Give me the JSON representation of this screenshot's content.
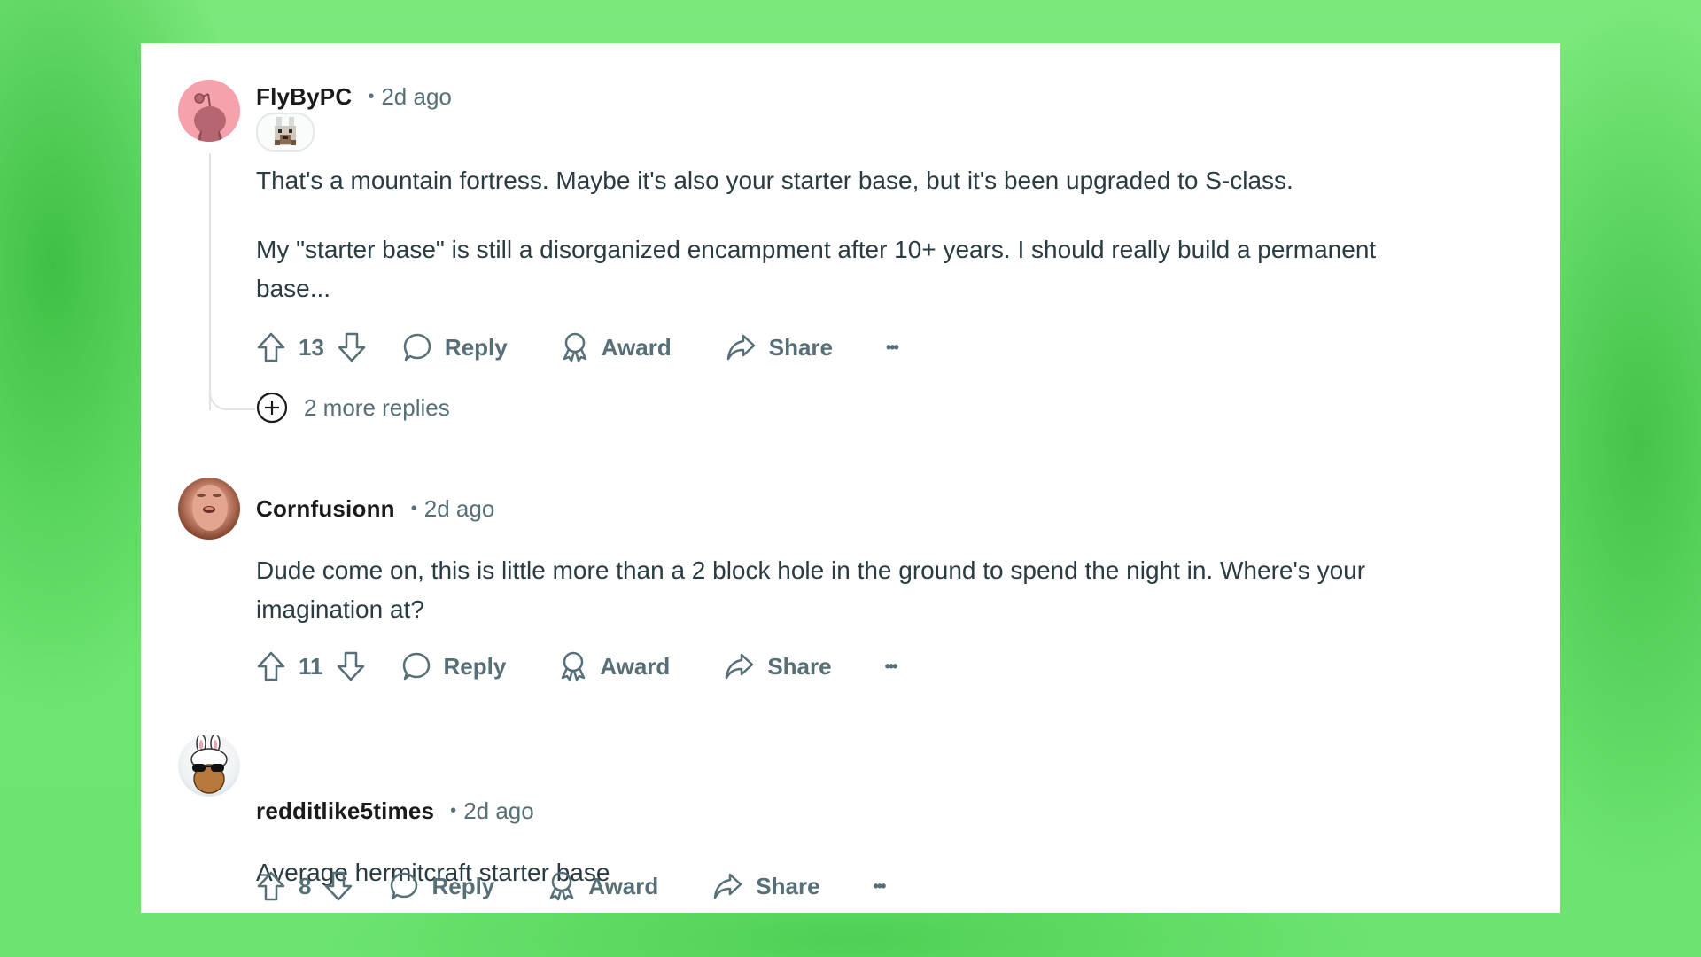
{
  "colors": {
    "background_green": "#6fe672",
    "card": "#ffffff",
    "text_primary": "#1a1a1b",
    "text_body": "#2a3c42",
    "text_muted": "#576f76",
    "avatar_pink": "#f6a2ac"
  },
  "comments": [
    {
      "username": "FlyByPC",
      "separator": "•",
      "time": "2d ago",
      "avatar": "snoo-default-avatar-pink",
      "flair": "minecraft-wolf-flair-icon",
      "paragraphs": [
        "That's a mountain fortress. Maybe it's also your starter base, but it's been upgraded to S-class.",
        "My \"starter base\" is still a disorganized encampment after 10+ years. I should really build a permanent base..."
      ],
      "score": "13",
      "actions": {
        "reply": "Reply",
        "award": "Award",
        "share": "Share",
        "more": "•••"
      },
      "more_replies": "2 more replies"
    },
    {
      "username": "Cornfusionn",
      "separator": "•",
      "time": "2d ago",
      "avatar": "photo-face-avatar",
      "paragraphs": [
        "Dude come on, this is little more than a 2 block hole in the ground to spend the night in. Where's your imagination at?"
      ],
      "score": "11",
      "actions": {
        "reply": "Reply",
        "award": "Award",
        "share": "Share",
        "more": "•••"
      }
    },
    {
      "username": "redditlike5times",
      "separator": "•",
      "time": "2d ago",
      "avatar": "bunny-hat-sunglasses-avatar",
      "paragraphs": [
        "Average hermitcraft starter base"
      ],
      "score": "8",
      "actions": {
        "reply": "Reply",
        "award": "Award",
        "share": "Share",
        "more": "•••"
      }
    }
  ]
}
